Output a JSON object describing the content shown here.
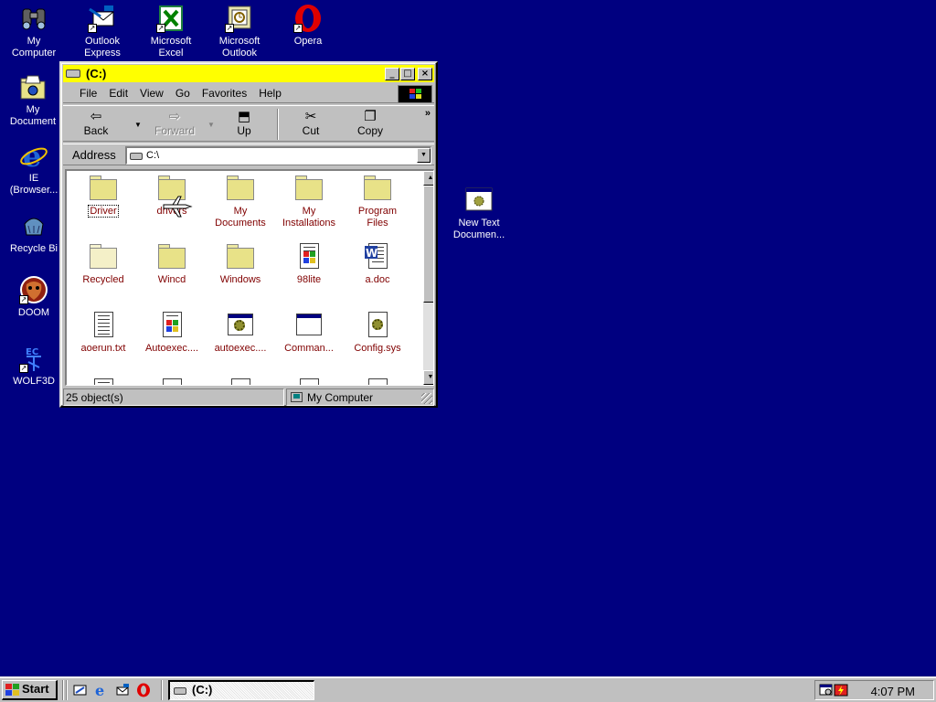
{
  "colors": {
    "desktop": "#000080",
    "titlebar_active": "#ffff00",
    "file_label": "#800000",
    "folder": "#e8e288"
  },
  "desktop": {
    "icons": [
      {
        "label": "My\nComputer",
        "icon": "binoculars-icon"
      },
      {
        "label": "Outlook\nExpress",
        "icon": "outlook-express-icon"
      },
      {
        "label": "Microsoft\nExcel",
        "icon": "excel-icon"
      },
      {
        "label": "Microsoft\nOutlook",
        "icon": "outlook-icon"
      },
      {
        "label": "Opera",
        "icon": "opera-icon"
      },
      {
        "label": "My\nDocument",
        "icon": "my-documents-icon"
      },
      {
        "label": "IE\n(Browser...",
        "icon": "internet-explorer-icon"
      },
      {
        "label": "Recycle Bi",
        "icon": "recycle-bin-icon"
      },
      {
        "label": "DOOM",
        "icon": "doom-icon"
      },
      {
        "label": "WOLF3D",
        "icon": "wolf3d-icon"
      },
      {
        "label": "New Text\nDocumen...",
        "icon": "text-document-icon"
      }
    ]
  },
  "window": {
    "title": "(C:)",
    "menu": [
      "File",
      "Edit",
      "View",
      "Go",
      "Favorites",
      "Help"
    ],
    "toolbar": {
      "back": "Back",
      "forward": "Forward",
      "up": "Up",
      "cut": "Cut",
      "copy": "Copy",
      "more": "»"
    },
    "address": {
      "label": "Address",
      "value": "C:\\"
    },
    "files": [
      {
        "name": "Driver",
        "type": "folder"
      },
      {
        "name": "drivers",
        "type": "folder"
      },
      {
        "name": "My\nDocuments",
        "type": "folder"
      },
      {
        "name": "My\nInstallations",
        "type": "folder"
      },
      {
        "name": "Program\nFiles",
        "type": "folder"
      },
      {
        "name": "Recycled",
        "type": "folder-hidden"
      },
      {
        "name": "Wincd",
        "type": "folder"
      },
      {
        "name": "Windows",
        "type": "folder"
      },
      {
        "name": "98lite",
        "type": "exe"
      },
      {
        "name": "a.doc",
        "type": "word"
      },
      {
        "name": "aoerun.txt",
        "type": "text"
      },
      {
        "name": "Autoexec....",
        "type": "exe"
      },
      {
        "name": "autoexec....",
        "type": "settings"
      },
      {
        "name": "Comman...",
        "type": "window"
      },
      {
        "name": "Config.sys",
        "type": "gear"
      }
    ],
    "status": {
      "objects": "25 object(s)",
      "location": "My Computer"
    }
  },
  "taskbar": {
    "start": "Start",
    "task": "(C:)",
    "clock": "4:07 PM"
  }
}
